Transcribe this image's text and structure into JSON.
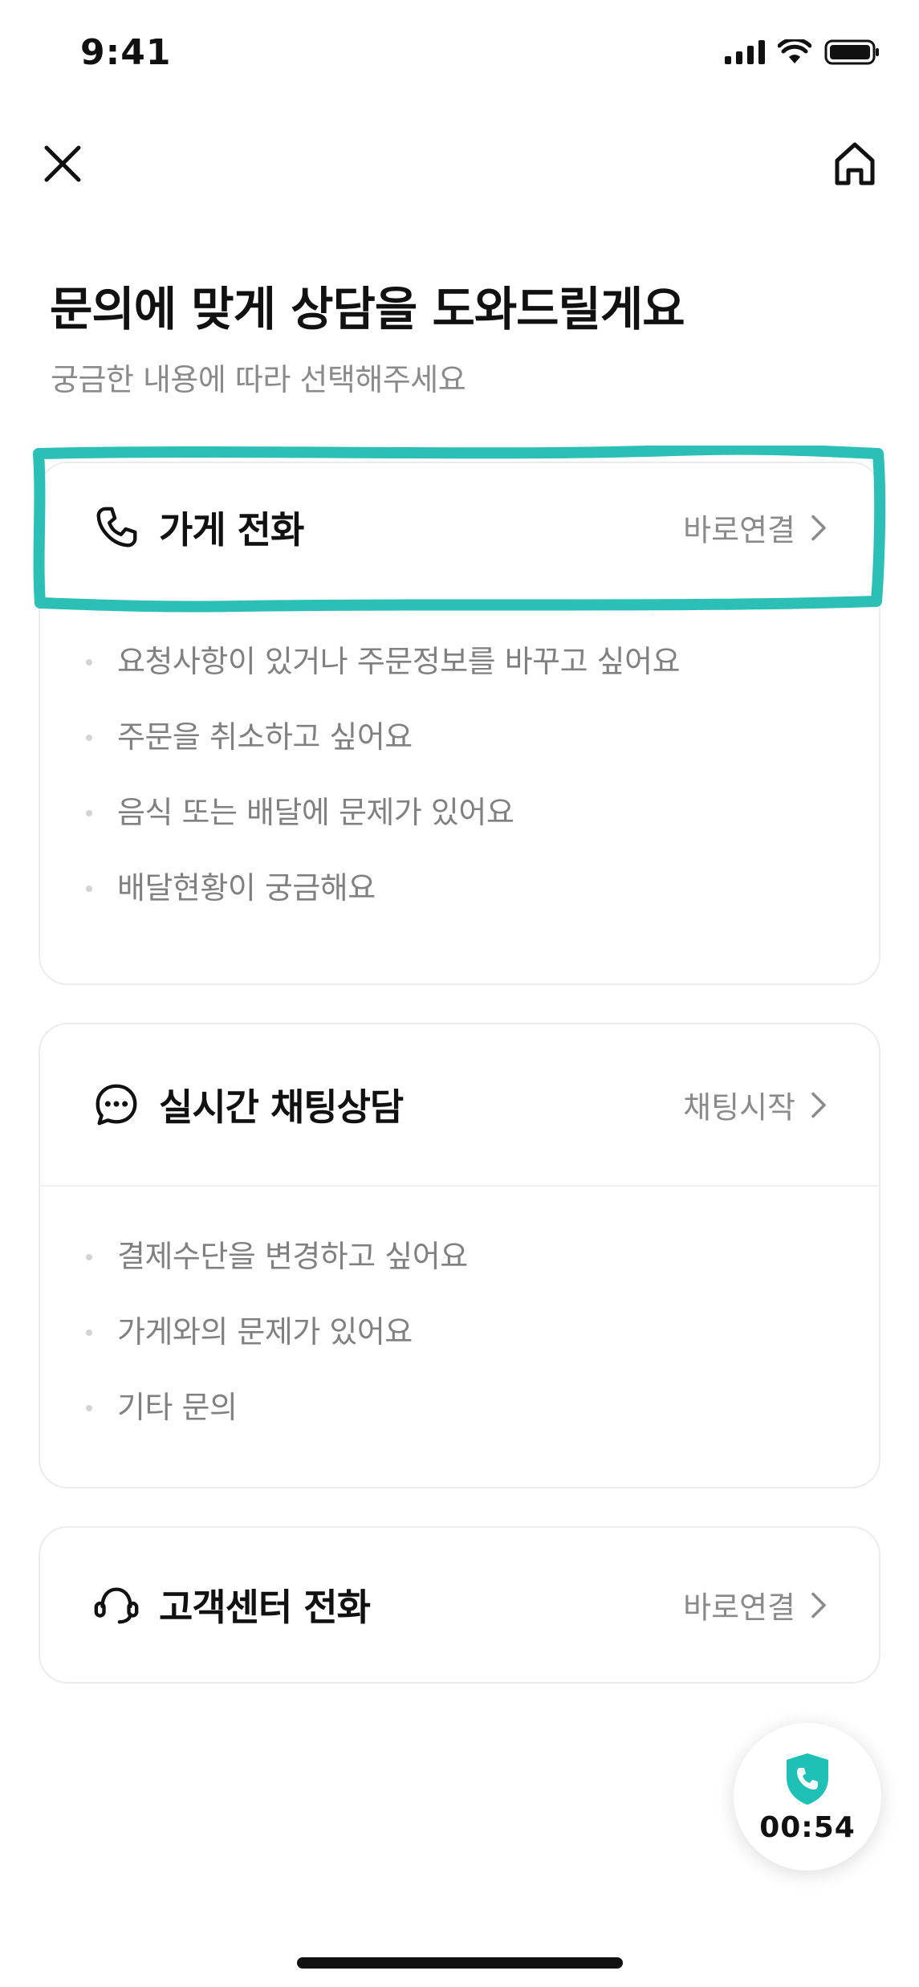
{
  "status_bar": {
    "time": "9:41"
  },
  "header": {
    "title": "문의에 맞게 상담을 도와드릴게요",
    "subtitle": "궁금한 내용에 따라 선택해주세요"
  },
  "cards": [
    {
      "title": "가게 전화",
      "action": "바로연결",
      "icon": "phone-icon",
      "items": [
        "요청사항이 있거나 주문정보를 바꾸고 싶어요",
        "주문을 취소하고 싶어요",
        "음식 또는 배달에 문제가 있어요",
        "배달현황이 궁금해요"
      ]
    },
    {
      "title": "실시간 채팅상담",
      "action": "채팅시작",
      "icon": "chat-bubble-icon",
      "items": [
        "결제수단을 변경하고 싶어요",
        "가게와의 문제가 있어요",
        "기타 문의"
      ]
    },
    {
      "title": "고객센터 전화",
      "action": "바로연결",
      "icon": "headset-icon",
      "items": []
    }
  ],
  "call_widget": {
    "timer": "00:54"
  },
  "colors": {
    "highlight": "#2bbfb6",
    "accent": "#1fc0b6",
    "muted_text": "#8a8a8a",
    "card_border": "#ececec"
  }
}
